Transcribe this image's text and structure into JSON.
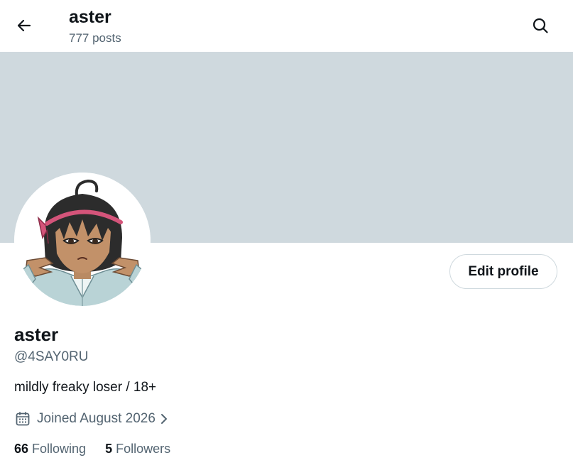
{
  "header": {
    "title": "aster",
    "posts_count": "777 posts",
    "back_icon": "arrow-left-icon",
    "search_icon": "search-icon"
  },
  "banner": {
    "color": "#cfd9de"
  },
  "profile": {
    "avatar_icon": "avatar",
    "edit_button_label": "Edit profile",
    "display_name": "aster",
    "handle": "@4SAY0RU",
    "bio": "mildly freaky loser / 18+",
    "joined_text": "Joined August 2026",
    "joined_icon": "calendar-icon",
    "joined_chevron": "chevron-right-icon"
  },
  "stats": {
    "following_count": "66",
    "following_label": "Following",
    "followers_count": "5",
    "followers_label": "Followers"
  },
  "colors": {
    "text_primary": "#0f1419",
    "text_secondary": "#536471",
    "border": "#cfd9de",
    "headband": "#d4547a"
  }
}
